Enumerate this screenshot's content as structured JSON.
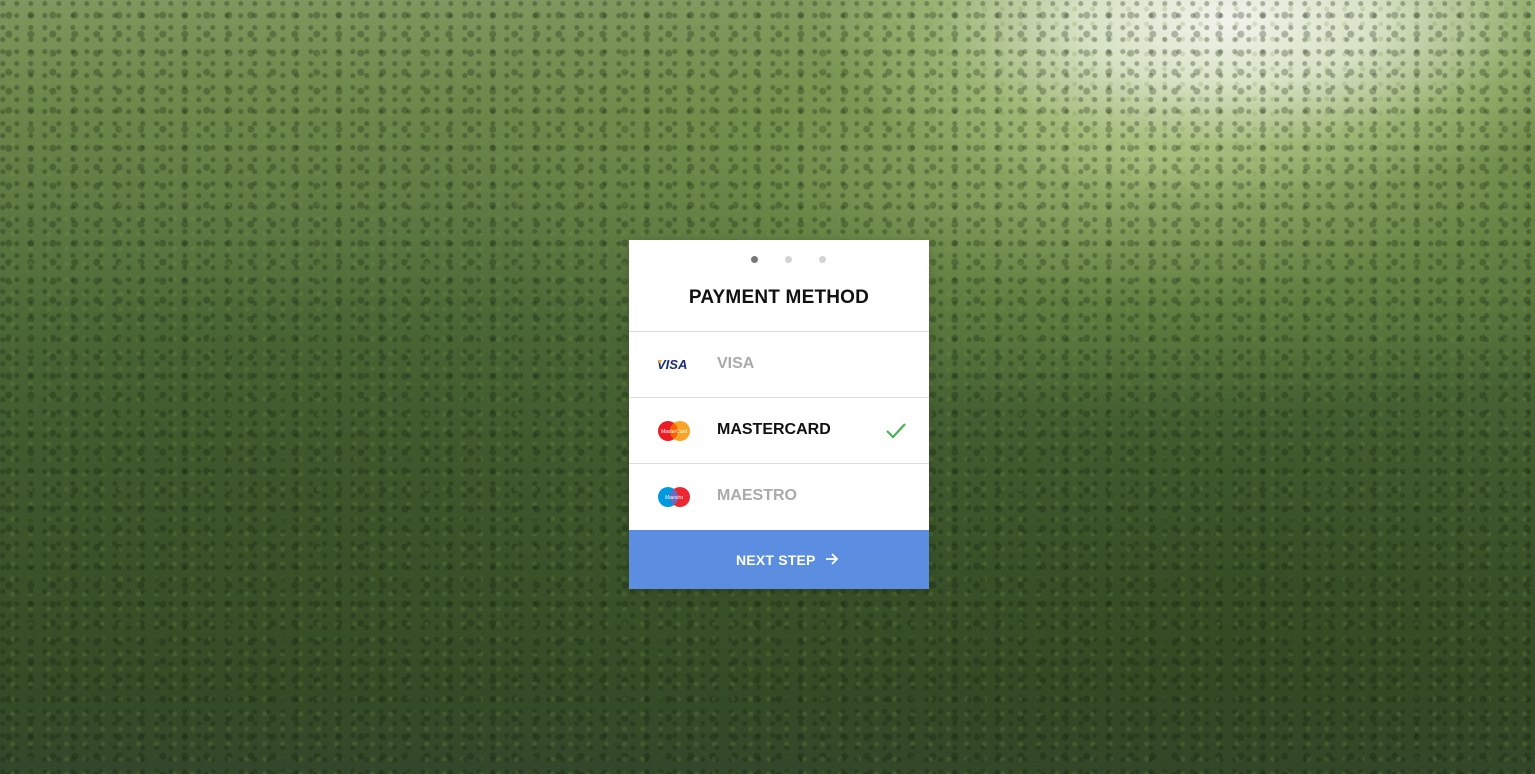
{
  "card": {
    "step_dots": [
      {
        "label": "step-1",
        "active": true
      },
      {
        "label": "step-2",
        "active": false
      },
      {
        "label": "step-3",
        "active": false
      }
    ],
    "title": "PAYMENT METHOD",
    "options": [
      {
        "label": "VISA",
        "icon": "visa-logo-icon",
        "selected": false
      },
      {
        "label": "MASTERCARD",
        "icon": "mastercard-logo-icon",
        "selected": true
      },
      {
        "label": "MAESTRO",
        "icon": "maestro-logo-icon",
        "selected": false
      }
    ],
    "next_button_label": "NEXT STEP",
    "next_button_icon": "arrow-right-icon",
    "selected_check_icon": "checkmark-icon"
  },
  "colors": {
    "accent": "#5b8ee0",
    "check": "#4caf50",
    "selected_text": "#111111",
    "unselected_text": "#aaaaaa",
    "dot_active": "#777777",
    "dot_inactive": "#d4d4d4"
  }
}
